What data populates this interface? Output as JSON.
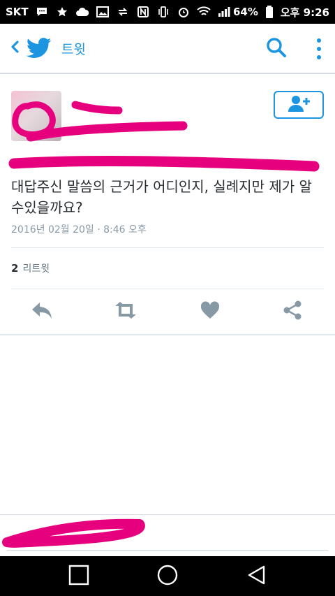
{
  "status_bar": {
    "carrier": "SKT",
    "battery": "64%",
    "time": "오후 9:26"
  },
  "app_bar": {
    "title": "트윗",
    "icons": [
      "back-icon",
      "twitter-bird-icon",
      "search-icon",
      "more-vert-icon"
    ]
  },
  "tweet": {
    "author_name": "",
    "text": "대답주신 말씀의 근거가 어디인지, 실례지만 제가 알 수있을까요?",
    "timestamp": "2016년 02월 20일 · 8:46 오후",
    "retweet_count": "2",
    "retweet_label": "리트윗",
    "follow_icon": "add-user-icon",
    "actions": [
      "reply-icon",
      "retweet-icon",
      "like-icon",
      "share-icon"
    ]
  },
  "colors": {
    "accent": "#1b95e0",
    "redaction": "#e6007e",
    "text": "#292f33",
    "muted": "#8899a6",
    "action_icon": "#8899a6"
  },
  "nav_bar": {
    "icons": [
      "recents-square-icon",
      "home-circle-icon",
      "back-triangle-icon"
    ]
  }
}
